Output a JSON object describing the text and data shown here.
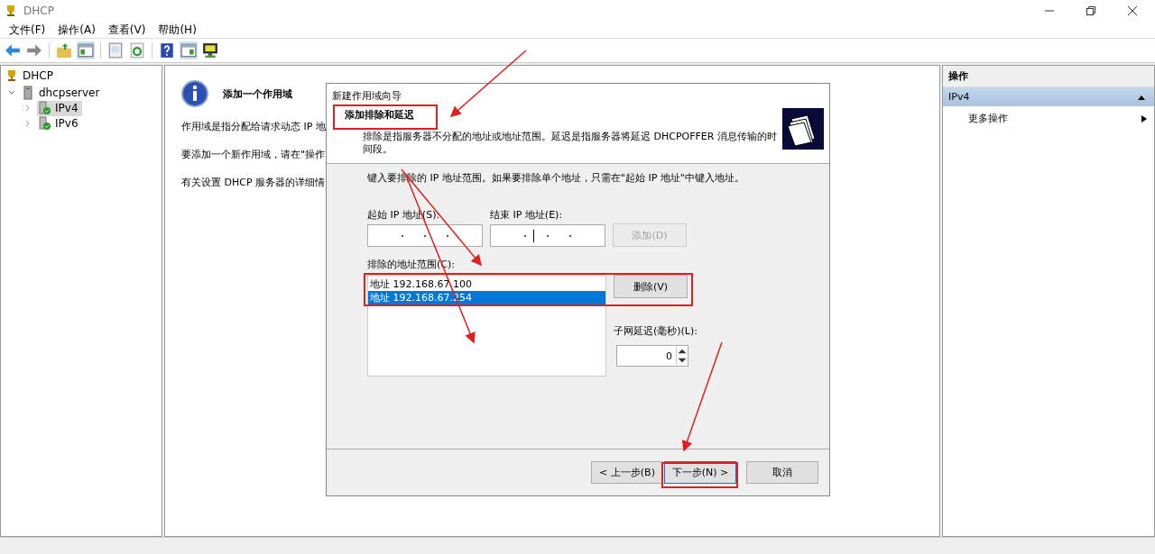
{
  "window": {
    "title": "DHCP"
  },
  "menu": [
    "文件(F)",
    "操作(A)",
    "查看(V)",
    "帮助(H)"
  ],
  "tree": [
    {
      "label": "DHCP",
      "kind": "root",
      "selected": false,
      "children": [
        {
          "label": "dhcpserver",
          "kind": "server",
          "selected": false,
          "expanded": true,
          "children": [
            {
              "label": "IPv4",
              "kind": "protocol",
              "selected": true,
              "expanded": false
            },
            {
              "label": "IPv6",
              "kind": "protocol",
              "selected": false,
              "expanded": false
            }
          ]
        }
      ]
    }
  ],
  "center": {
    "title": "添加一个作用域",
    "paragraphs": [
      "作用域是指分配给请求动态 IP 地",
      "要添加一个新作用域，请在\"操作",
      "有关设置 DHCP 服务器的详细情"
    ]
  },
  "actions": {
    "header": "操作",
    "section": "IPv4",
    "expanded": true,
    "items": [
      "更多操作"
    ]
  },
  "dialog": {
    "title": "新建作用域向导",
    "heading": "添加排除和延迟",
    "description": "排除是指服务器不分配的地址或地址范围。延迟是指服务器将延迟 DHCPOFFER 消息传输的时间段。",
    "instruction": "键入要排除的 IP 地址范围。如果要排除单个地址，只需在\"起始 IP 地址\"中键入地址。",
    "start_ip": {
      "label": "起始 IP 地址(S):"
    },
    "end_ip": {
      "label": "结束 IP 地址(E):"
    },
    "add_button": {
      "label": "添加(D)",
      "disabled": true
    },
    "list_label": "排除的地址范围(C):",
    "ranges": [
      {
        "text": "地址 192.168.67.100",
        "selected": false
      },
      {
        "text": "地址 192.168.67.254",
        "selected": true
      }
    ],
    "delete_button": {
      "label": "删除(V)",
      "disabled": false
    },
    "delay_label": "子网延迟(毫秒)(L):",
    "delay_value": "0",
    "buttons": [
      {
        "label": "< 上一步(B)",
        "kind": "back"
      },
      {
        "label": "下一步(N) >",
        "kind": "next"
      },
      {
        "label": "取消",
        "kind": "cancel"
      }
    ]
  }
}
